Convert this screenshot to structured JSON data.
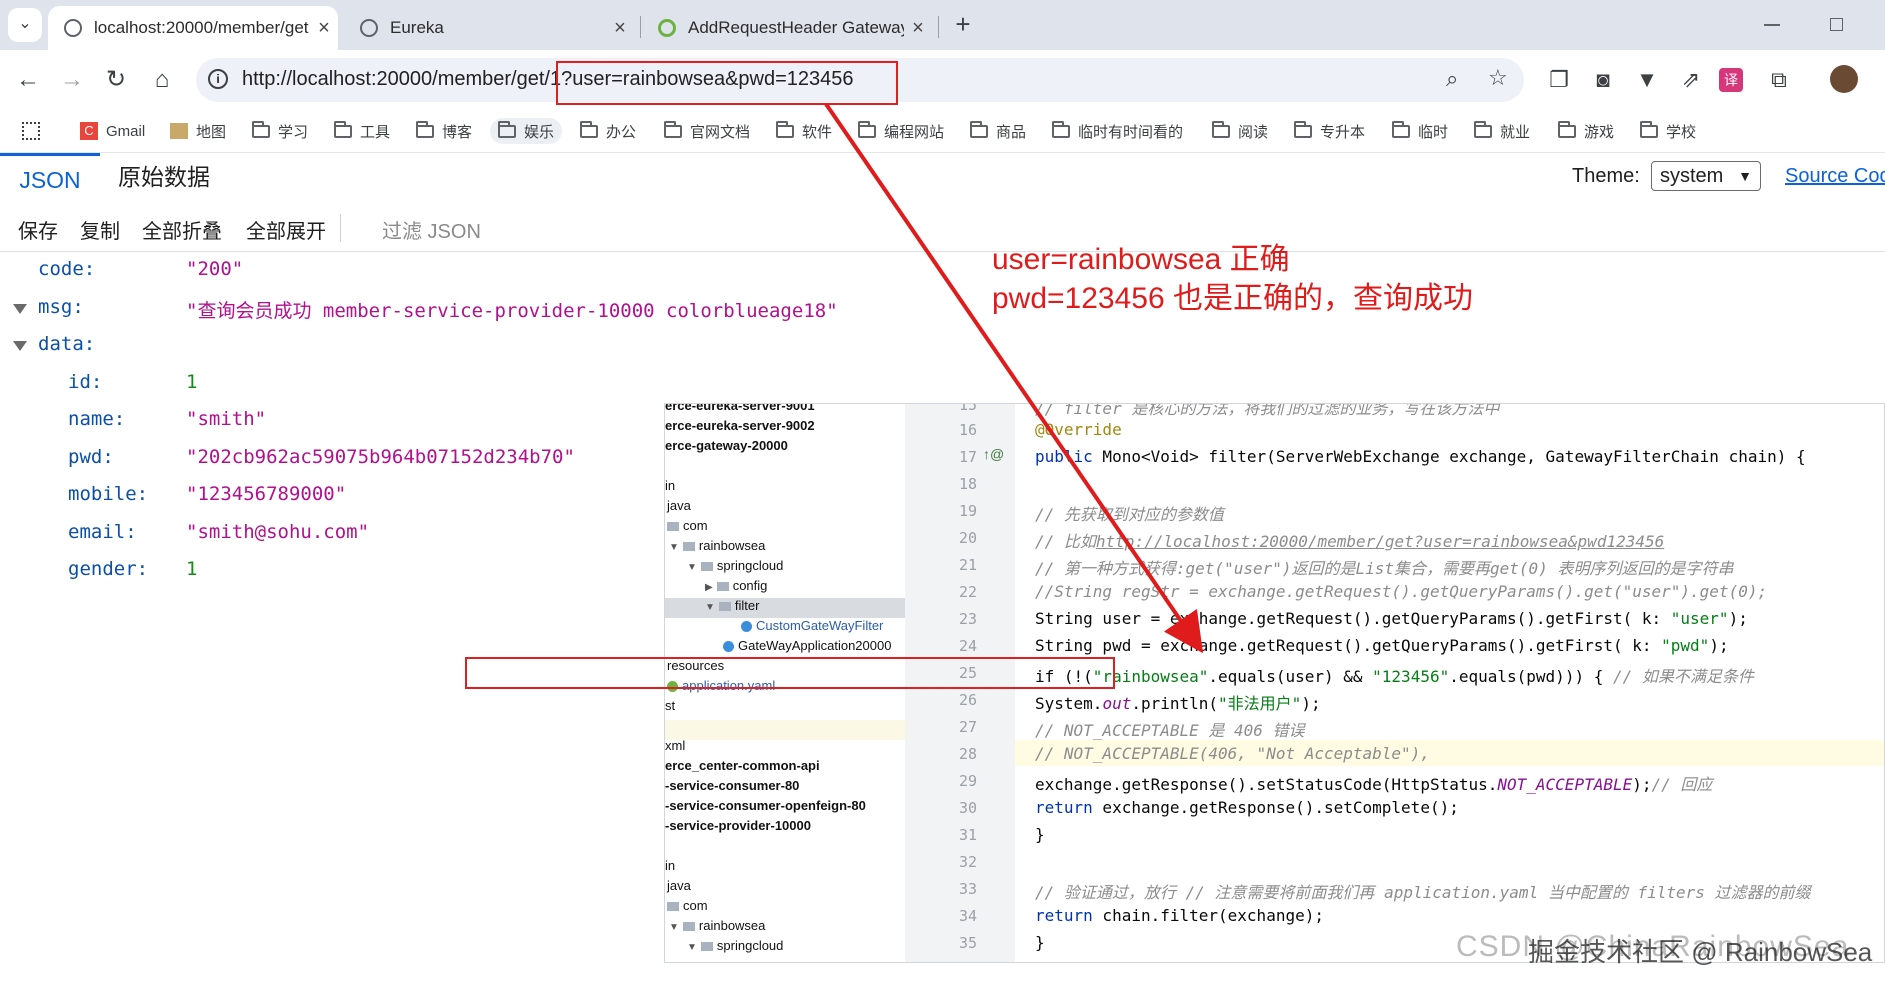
{
  "browser": {
    "tabs": [
      {
        "title": "localhost:20000/member/get",
        "favicon_color": "#5f6368"
      },
      {
        "title": "Eureka",
        "favicon_color": "#5f6368"
      },
      {
        "title": "AddRequestHeader GatewayF",
        "favicon_color": "#6db33f"
      }
    ],
    "close_glyph": "×",
    "new_tab_glyph": "+",
    "url": "http://localhost:20000/member/get/1?user=rainbowsea&pwd=123456",
    "bookmarks": [
      {
        "label": "Gmail",
        "icon": "gmail-icon"
      },
      {
        "label": "地图",
        "icon": "maps-icon"
      },
      {
        "label": "学习",
        "icon": "folder-icon"
      },
      {
        "label": "工具",
        "icon": "folder-icon"
      },
      {
        "label": "博客",
        "icon": "folder-icon"
      },
      {
        "label": "娱乐",
        "icon": "folder-icon"
      },
      {
        "label": "办公",
        "icon": "folder-icon"
      },
      {
        "label": "官网文档",
        "icon": "folder-icon"
      },
      {
        "label": "软件",
        "icon": "folder-icon"
      },
      {
        "label": "编程网站",
        "icon": "folder-icon"
      },
      {
        "label": "商品",
        "icon": "folder-icon"
      },
      {
        "label": "临时有时间看的",
        "icon": "folder-icon"
      },
      {
        "label": "阅读",
        "icon": "folder-icon"
      },
      {
        "label": "专升本",
        "icon": "folder-icon"
      },
      {
        "label": "临时",
        "icon": "folder-icon"
      },
      {
        "label": "就业",
        "icon": "folder-icon"
      },
      {
        "label": "游戏",
        "icon": "folder-icon"
      },
      {
        "label": "学校",
        "icon": "folder-icon"
      }
    ]
  },
  "viewer": {
    "tab_json": "JSON",
    "tab_raw": "原始数据",
    "theme_label": "Theme:",
    "theme_value": "system",
    "source_link": "Source Code",
    "actions": {
      "save": "保存",
      "copy": "复制",
      "collapse_all": "全部折叠",
      "expand_all": "全部展开",
      "filter": "过滤 JSON"
    }
  },
  "json": {
    "code_key": "code:",
    "code_val": "\"200\"",
    "msg_key": "msg:",
    "msg_val": "\"查询会员成功 member-service-provider-10000  colorblueage18\"",
    "data_key": "data:",
    "id_key": "id:",
    "id_val": "1",
    "name_key": "name:",
    "name_val": "\"smith\"",
    "pwd_key": "pwd:",
    "pwd_val": "\"202cb962ac59075b964b07152d234b70\"",
    "mobile_key": "mobile:",
    "mobile_val": "\"123456789000\"",
    "email_key": "email:",
    "email_val": "\"smith@sohu.com\"",
    "gender_key": "gender:",
    "gender_val": "1"
  },
  "annotation": {
    "line1": "user=rainbowsea 正确",
    "line2": "pwd=123456 也是正确的，查询成功",
    "color": "#e01b1b"
  },
  "ide": {
    "tree": [
      "erce-eureka-server-9001",
      "erce-eureka-server-9002",
      "erce-gateway-20000",
      "in",
      "java",
      "com",
      "rainbowsea",
      "springcloud",
      "config",
      "filter",
      "CustomGateWayFilter",
      "GateWayApplication20000",
      "resources",
      "application.yaml",
      "st",
      "",
      "xml",
      "erce_center-common-api",
      "-service-consumer-80",
      "-service-consumer-openfeign-80",
      "-service-provider-10000",
      "",
      "in",
      "java",
      "com",
      "rainbowsea",
      "springcloud"
    ],
    "line_numbers": [
      "15",
      "16",
      "17",
      "18",
      "19",
      "20",
      "21",
      "22",
      "23",
      "24",
      "25",
      "26",
      "27",
      "28",
      "29",
      "30",
      "31",
      "32",
      "33",
      "34",
      "35"
    ],
    "gutter_marks": "↑@",
    "code": {
      "l15": "    // filter 是核心的方法，将我们的过滤的业务，写在该方法中",
      "l16": "@Override",
      "l17a": "public",
      "l17b": " Mono<Void> filter(ServerWebExchange exchange, GatewayFilterChain chain) {",
      "l19": "    // 先获取到对应的参数值",
      "l20a": "    // 比如",
      "l20b": "http://localhost:20000/member/get?user=rainbowsea&pwd123456",
      "l21": "    // 第一种方式获得:get(\"user\")返回的是List集合，需要再get(0) 表明序列返回的是字符串",
      "l22": "    //String regStr = exchange.getRequest().getQueryParams().get(\"user\").get(0);",
      "l23a": "    String user = exchange.getRequest().getQueryParams().getFirst( k: ",
      "l23b": "\"user\"",
      "l23c": ");",
      "l24a": "    String pwd = exchange.getRequest().getQueryParams().getFirst( k: ",
      "l24b": "\"pwd\"",
      "l24c": ");",
      "l25a": "    if (!(",
      "l25b": "\"rainbowsea\"",
      "l25c": ".equals(user) && ",
      "l25d": "\"123456\"",
      "l25e": ".equals(pwd))) { ",
      "l25f": "// 如果不满足条件",
      "l26a": "        System.",
      "l26b": "out",
      "l26c": ".println(",
      "l26d": "\"非法用户\"",
      "l26e": ");",
      "l27": "        // NOT_ACCEPTABLE 是 406 错误",
      "l28": "        // NOT_ACCEPTABLE(406, \"Not Acceptable\"),",
      "l29a": "        exchange.getResponse().setStatusCode(HttpStatus.",
      "l29b": "NOT_ACCEPTABLE",
      "l29c": ");",
      "l29d": "// 回应",
      "l30a": "        ",
      "l30b": "return",
      "l30c": " exchange.getResponse().setComplete();",
      "l31": "    }",
      "l33": "    // 验证通过，放行 // 注意需要将前面我们再 application.yaml 当中配置的 filters 过滤器的前缀",
      "l34a": "    ",
      "l34b": "return",
      "l34c": " chain.filter(exchange);",
      "l35": "}"
    }
  },
  "watermark": "掘金技术社区 @ RainbowSea",
  "watermark_bg": "CSDN @ChinaRainbowSea"
}
